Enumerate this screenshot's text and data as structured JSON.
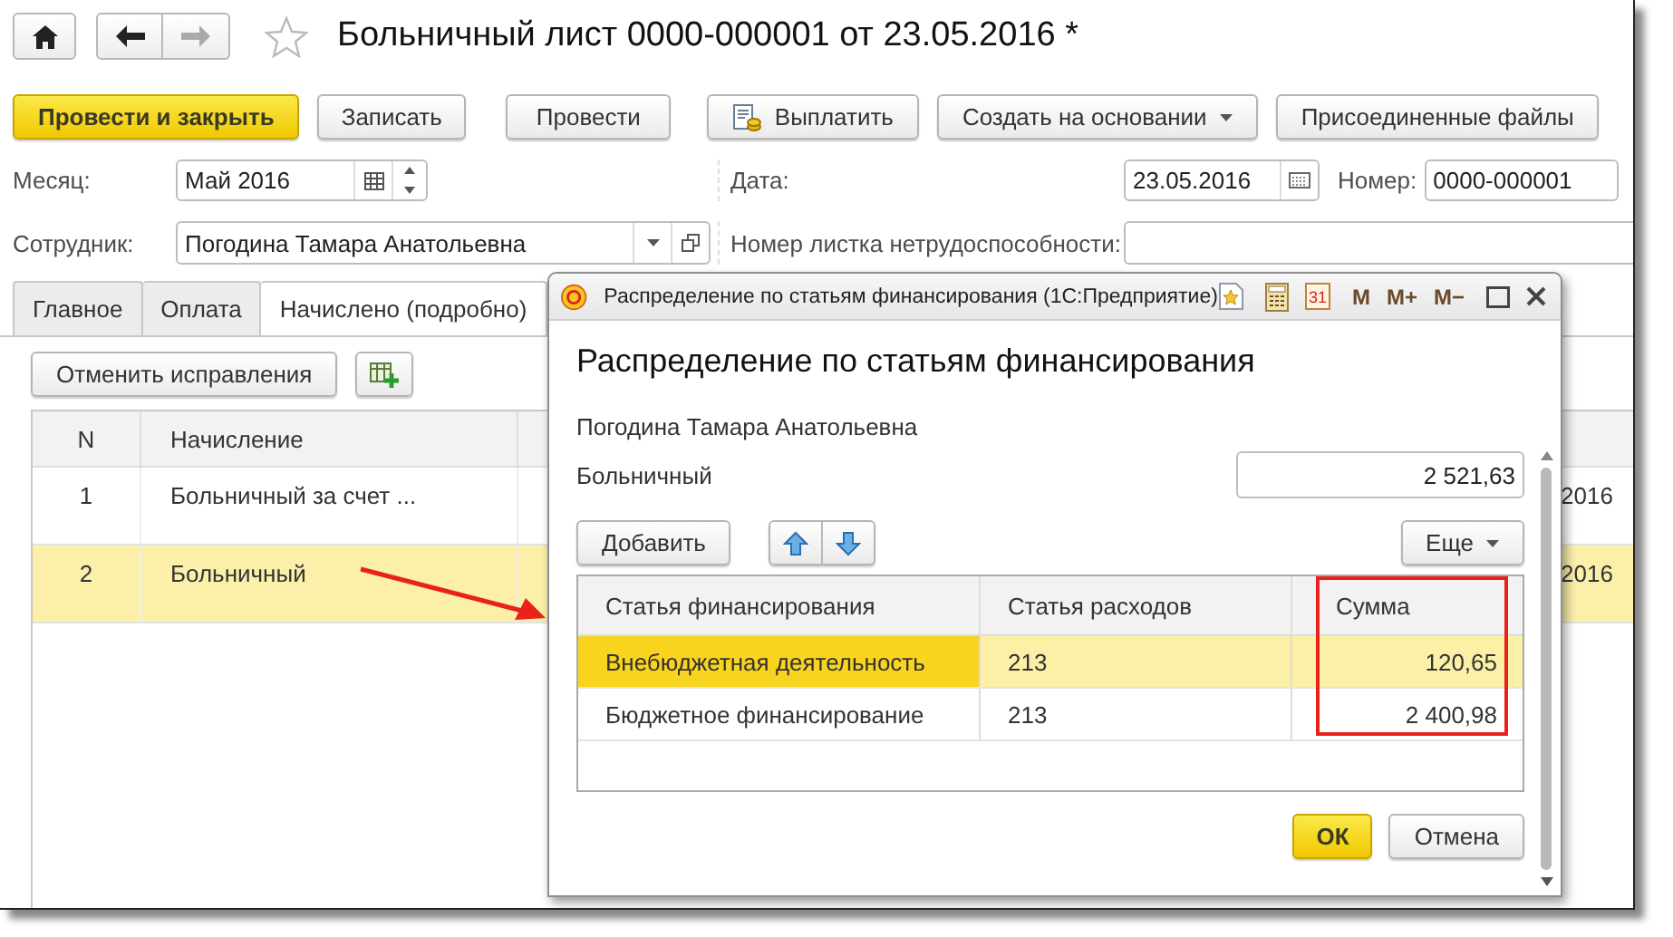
{
  "title": "Больничный лист 0000-000001 от 23.05.2016 *",
  "command_bar": [
    {
      "label": "Провести и закрыть",
      "kind": "primary"
    },
    {
      "label": "Записать",
      "kind": "plain"
    },
    {
      "label": "Провести",
      "kind": "plain"
    },
    {
      "label": "Выплатить",
      "kind": "with_icon"
    },
    {
      "label": "Создать на основании",
      "kind": "menu"
    },
    {
      "label": "Присоединенные файлы",
      "kind": "plain"
    }
  ],
  "fields": {
    "month": {
      "label": "Месяц:",
      "value": "Май 2016"
    },
    "date": {
      "label": "Дата:",
      "value": "23.05.2016"
    },
    "number": {
      "label": "Номер:",
      "value": "0000-000001"
    },
    "employee": {
      "label": "Сотрудник:",
      "value": "Погодина Тамара Анатольевна"
    },
    "sick_note": {
      "label": "Номер листка нетрудоспособности:"
    }
  },
  "tabs": [
    {
      "label": "Главное",
      "selected": false
    },
    {
      "label": "Оплата",
      "selected": false
    },
    {
      "label": "Начислено (подробно)",
      "selected": true
    }
  ],
  "tab_toolbar": {
    "button": "Отменить исправления"
  },
  "table": {
    "columns": [
      "N",
      "Начисление"
    ],
    "rows": [
      {
        "n": "1",
        "accrual": "Больничный за счет ...",
        "column_end": "2016",
        "selected": false
      },
      {
        "n": "2",
        "accrual": "Больничный",
        "column_end": "2016",
        "selected": true
      }
    ]
  },
  "dialog": {
    "window_title": "Распределение по статьям финансирования  (1С:Предприятие)",
    "title_tools": [
      {
        "kind": "favorite"
      },
      {
        "kind": "calculator"
      },
      {
        "kind": "calendar",
        "label": "31"
      },
      {
        "kind": "memory",
        "label": "M"
      },
      {
        "kind": "memory",
        "label": "M+"
      },
      {
        "kind": "memory",
        "label": "M−"
      }
    ],
    "heading": "Распределение по статьям финансирования",
    "employee": "Погодина Тамара Анатольевна",
    "accrual": "Больничный",
    "total": "2 521,63",
    "add_button": "Добавить",
    "more_button": "Еще",
    "table": {
      "columns": [
        "Статья финансирования",
        "Статья расходов",
        "Сумма"
      ],
      "rows": [
        {
          "item": "Внебюджетная деятельность",
          "expense": "213",
          "amount": "120,65",
          "selected": true
        },
        {
          "item": "Бюджетное финансирование",
          "expense": "213",
          "amount": "2 400,98",
          "selected": false
        }
      ]
    },
    "buttons": [
      {
        "label": "ОК",
        "kind": "primary"
      },
      {
        "label": "Отмена",
        "kind": "plain"
      }
    ]
  }
}
